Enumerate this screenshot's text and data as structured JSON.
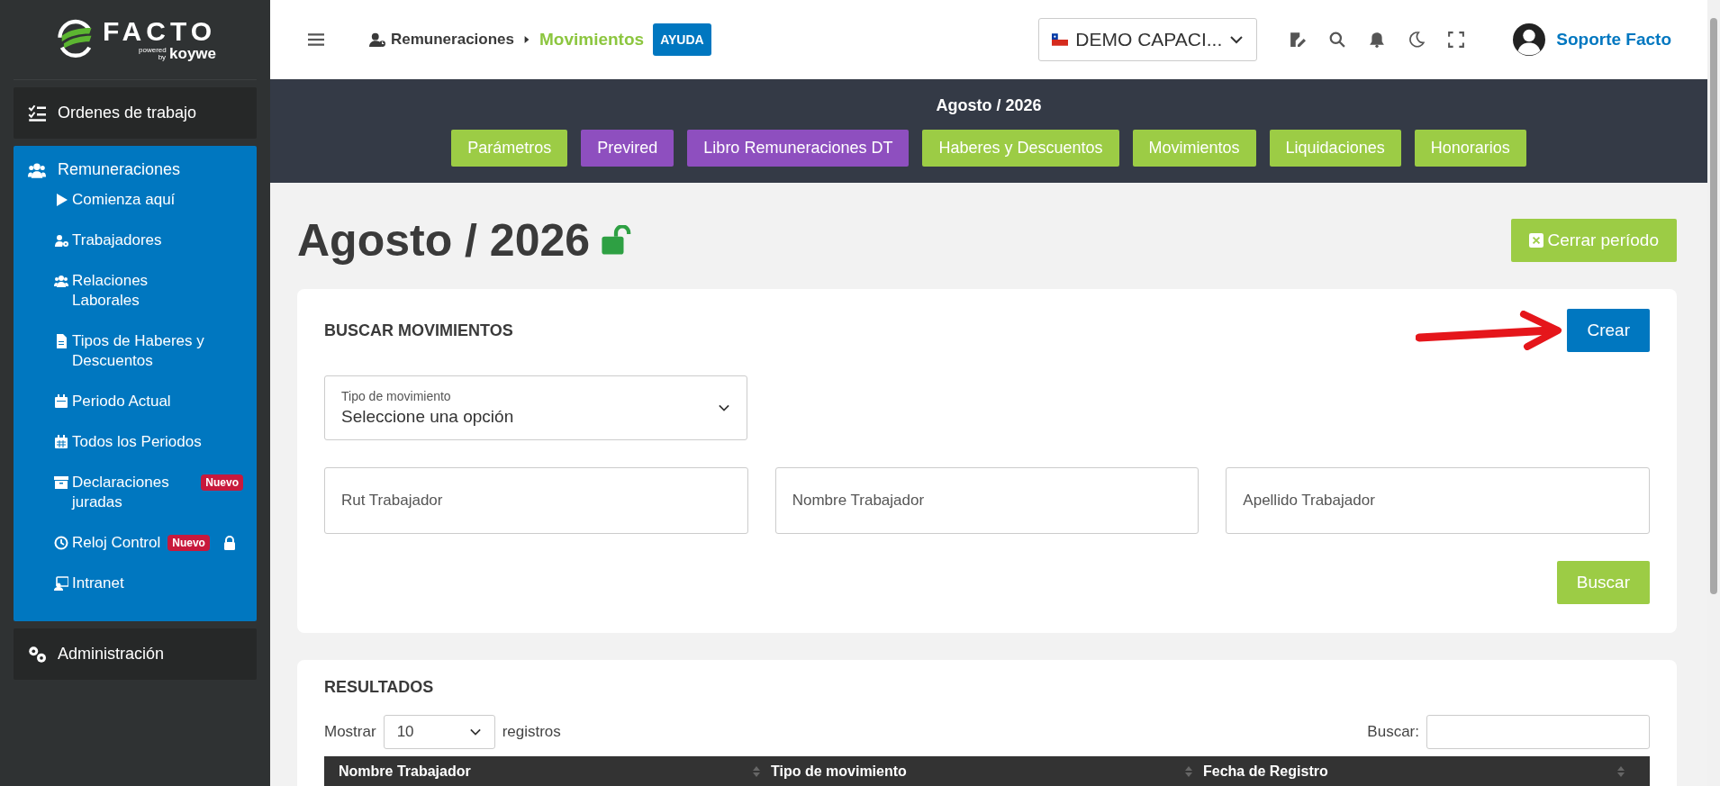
{
  "sidebar": {
    "logo": {
      "name": "FACTO",
      "powered": "powered by",
      "brand": "koywe"
    },
    "sections": [
      {
        "label": "Ordenes de trabajo",
        "selected": false
      },
      {
        "label": "Remuneraciones",
        "selected": true,
        "children": [
          {
            "label": "Comienza aquí"
          },
          {
            "label": "Trabajadores"
          },
          {
            "label": "Relaciones Laborales"
          },
          {
            "label": "Tipos de Haberes y Descuentos"
          },
          {
            "label": "Periodo Actual"
          },
          {
            "label": "Todos los Periodos"
          },
          {
            "label": "Declaraciones juradas",
            "badge": "Nuevo"
          },
          {
            "label": "Reloj Control",
            "badge": "Nuevo",
            "locked": true
          },
          {
            "label": "Intranet"
          }
        ]
      },
      {
        "label": "Administración",
        "selected": false
      }
    ]
  },
  "header": {
    "breadcrumb": [
      "Remuneraciones",
      "Movimientos"
    ],
    "help": "AYUDA",
    "company": "DEMO CAPACI...",
    "user": "Soporte Facto"
  },
  "period_bar": {
    "title": "Agosto / 2026",
    "tabs": [
      {
        "label": "Parámetros",
        "color": "#9ccc45"
      },
      {
        "label": "Previred",
        "color": "#8e4fbf"
      },
      {
        "label": "Libro Remuneraciones DT",
        "color": "#8e4fbf"
      },
      {
        "label": "Haberes y Descuentos",
        "color": "#9ccc45"
      },
      {
        "label": "Movimientos",
        "color": "#9ccc45"
      },
      {
        "label": "Liquidaciones",
        "color": "#9ccc45"
      },
      {
        "label": "Honorarios",
        "color": "#9ccc45"
      }
    ]
  },
  "page": {
    "title": "Agosto / 2026",
    "unlocked": true,
    "close_button": "Cerrar período"
  },
  "search_card": {
    "title": "BUSCAR MOVIMIENTOS",
    "create_button": "Crear",
    "type_select": {
      "label": "Tipo de movimiento",
      "value": "Seleccione una opción"
    },
    "fields": [
      {
        "placeholder": "Rut Trabajador"
      },
      {
        "placeholder": "Nombre Trabajador"
      },
      {
        "placeholder": "Apellido Trabajador"
      }
    ],
    "search_button": "Buscar"
  },
  "results_card": {
    "title": "RESULTADOS",
    "show_label": "Mostrar",
    "page_size": "10",
    "records_label": "registros",
    "search_label": "Buscar:",
    "table": {
      "columns": [
        "Nombre Trabajador",
        "Tipo de movimiento",
        "Fecha de Registro"
      ]
    }
  }
}
